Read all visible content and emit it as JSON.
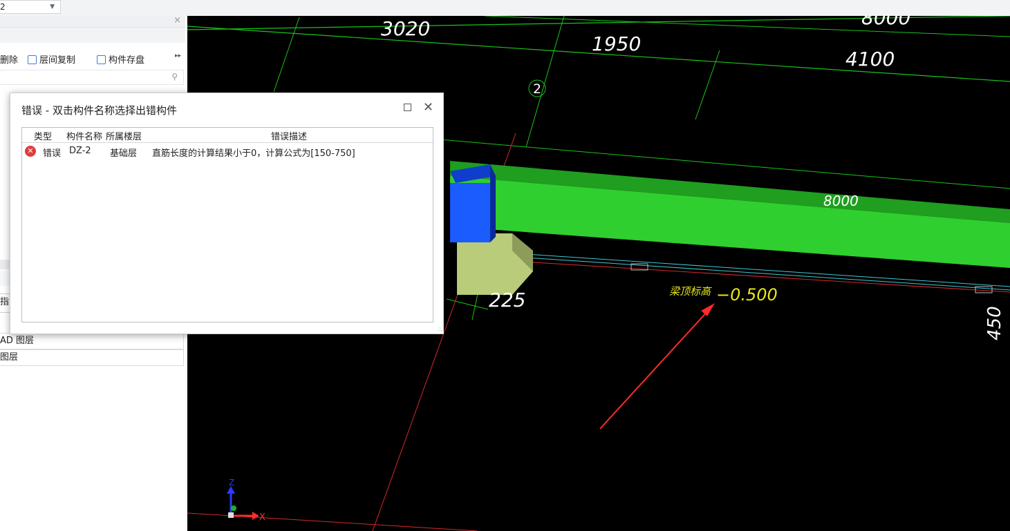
{
  "top": {
    "floor_value": "2"
  },
  "left_panel": {
    "toolbar": {
      "delete_label": "删除",
      "copy_label": "层间复制",
      "save_label": "构件存盘"
    },
    "side_tab_text": "指",
    "layers": [
      "AD 图层",
      "图层"
    ]
  },
  "dialog": {
    "title": "错误 - 双击构件名称选择出错构件",
    "columns": [
      "类型",
      "构件名称",
      "所属楼层",
      "错误描述"
    ],
    "rows": [
      {
        "type": "错误",
        "name": "DZ-2",
        "floor": "基础层",
        "description": "直筋长度的计算结果小于0，计算公式为[150-750]"
      }
    ]
  },
  "cad": {
    "dimensions": {
      "d3020": "3020",
      "d1950": "1950",
      "d8000_top": "8000",
      "d4100": "4100",
      "d8000_beam": "8000",
      "d225": "225",
      "d450": "450"
    },
    "axis_label": "2",
    "beam_label": "梁顶标高",
    "beam_elevation": "−0.500",
    "axes": {
      "x": "X",
      "z": "Z"
    },
    "colors": {
      "background": "#000000",
      "grid": "#19c419",
      "beam": "#2fcf2f",
      "column": "#1b5cff",
      "footing": "#b9cc7a",
      "annotation": "#e6e61a",
      "arrow": "#ff2a2a"
    }
  }
}
